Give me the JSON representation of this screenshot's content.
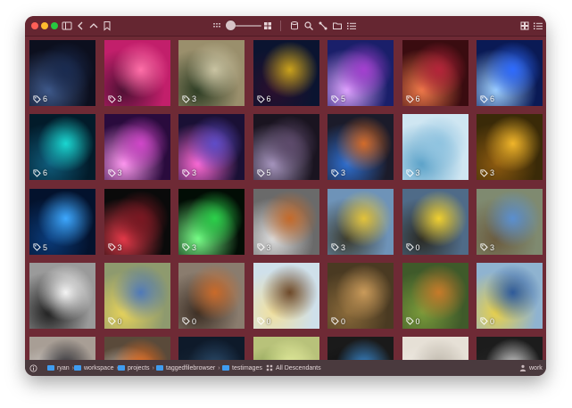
{
  "toolbar": {
    "icons": [
      "sidebar-icon",
      "back-icon",
      "up-icon",
      "bookmark-icon",
      "small-grid-icon",
      "large-grid-icon",
      "database-icon",
      "search-icon",
      "connect-icon",
      "folder-icon",
      "filter-list-icon",
      "grid-view-icon",
      "list-view-icon"
    ]
  },
  "grid": {
    "tiles": [
      {
        "count": "6",
        "colors": [
          "#0c0f1e",
          "#1a2b50",
          "#3f5a8c"
        ]
      },
      {
        "count": "3",
        "colors": [
          "#c21f6b",
          "#ff6fa8",
          "#4d1033"
        ]
      },
      {
        "count": "3",
        "colors": [
          "#9a8f6c",
          "#c9c3a2",
          "#2b3b22"
        ]
      },
      {
        "count": "6",
        "colors": [
          "#0b1430",
          "#caa21c",
          "#2a0f2e"
        ]
      },
      {
        "count": "5",
        "colors": [
          "#1a1f6a",
          "#a43fd0",
          "#e0a5ff"
        ]
      },
      {
        "count": "6",
        "colors": [
          "#3a0c10",
          "#b5243a",
          "#f07a4a"
        ]
      },
      {
        "count": "6",
        "colors": [
          "#0a1a55",
          "#2e6bff",
          "#9fd0ff"
        ]
      },
      {
        "count": "6",
        "colors": [
          "#021b2a",
          "#1ad7d1",
          "#0f5b7a"
        ]
      },
      {
        "count": "3",
        "colors": [
          "#2a0b3d",
          "#d046c9",
          "#ff9af0"
        ]
      },
      {
        "count": "3",
        "colors": [
          "#1a1035",
          "#5f4cc8",
          "#ff6ad5"
        ]
      },
      {
        "count": "5",
        "colors": [
          "#1a1420",
          "#5d4a6b",
          "#a897c0"
        ]
      },
      {
        "count": "3",
        "colors": [
          "#1b1b2a",
          "#d36b2a",
          "#2f6fd0"
        ]
      },
      {
        "count": "3",
        "colors": [
          "#cfe6f2",
          "#8fc3e0",
          "#5aa1c8"
        ]
      },
      {
        "count": "3",
        "colors": [
          "#3a2a08",
          "#f0b52a",
          "#8c5a10"
        ]
      },
      {
        "count": "5",
        "colors": [
          "#03122d",
          "#3da8ff",
          "#0a3b7a"
        ]
      },
      {
        "count": "3",
        "colors": [
          "#0a0a0a",
          "#7a1822",
          "#e83a4a"
        ]
      },
      {
        "count": "3",
        "colors": [
          "#020d05",
          "#2bd14a",
          "#7bff8a"
        ]
      },
      {
        "count": "3",
        "colors": [
          "#6a6a6a",
          "#c46a2a",
          "#dcdcdc"
        ]
      },
      {
        "count": "3",
        "colors": [
          "#6e93b8",
          "#e2c23a",
          "#3a3a2e"
        ]
      },
      {
        "count": "0",
        "colors": [
          "#4f6b88",
          "#f0d030",
          "#2a2a24"
        ]
      },
      {
        "count": "3",
        "colors": [
          "#7f8a70",
          "#5a8fd0",
          "#6b5b3e"
        ]
      },
      {
        "count": "",
        "colors": [
          "#9a9a9a",
          "#f4f4f4",
          "#1e1e1e"
        ]
      },
      {
        "count": "0",
        "colors": [
          "#8e9a6e",
          "#4f79b8",
          "#e6d25a"
        ]
      },
      {
        "count": "0",
        "colors": [
          "#8a7c6e",
          "#c96a2a",
          "#3c2e24"
        ]
      },
      {
        "count": "0",
        "colors": [
          "#cfe0ea",
          "#6e4a2a",
          "#f0e0a0"
        ]
      },
      {
        "count": "0",
        "colors": [
          "#4a3a22",
          "#c99a5a",
          "#8a6a3a"
        ]
      },
      {
        "count": "0",
        "colors": [
          "#3f5a2a",
          "#c67a2a",
          "#7a9a3a"
        ]
      },
      {
        "count": "0",
        "colors": [
          "#8fb3d0",
          "#2e5a9a",
          "#e8d04a"
        ]
      },
      {
        "count": "",
        "colors": [
          "#a89e95",
          "#2a2a30",
          "#dcdcdc"
        ]
      },
      {
        "count": "",
        "colors": [
          "#5a4a3a",
          "#e86a1a",
          "#f4f0ea"
        ]
      },
      {
        "count": "",
        "colors": [
          "#0e1a2a",
          "#2a4a6a",
          "#1a2a3a"
        ]
      },
      {
        "count": "",
        "colors": [
          "#b8c27a",
          "#e8f0a0",
          "#6a8a3a"
        ]
      },
      {
        "count": "",
        "colors": [
          "#1a1a1a",
          "#3a8ad0",
          "#0a0a0a"
        ]
      },
      {
        "count": "",
        "colors": [
          "#e6e0d6",
          "#bdb6aa",
          "#f4f0ea"
        ]
      },
      {
        "count": "",
        "colors": [
          "#1c1c1c",
          "#d0d0d0",
          "#2a2a2a"
        ]
      }
    ]
  },
  "status": {
    "info_icon": "info-icon",
    "path": [
      "ryan",
      "workspace",
      "projects",
      "taggedfilebrowser",
      "testimages"
    ],
    "scope": "All Descendants",
    "workspace": "work"
  }
}
